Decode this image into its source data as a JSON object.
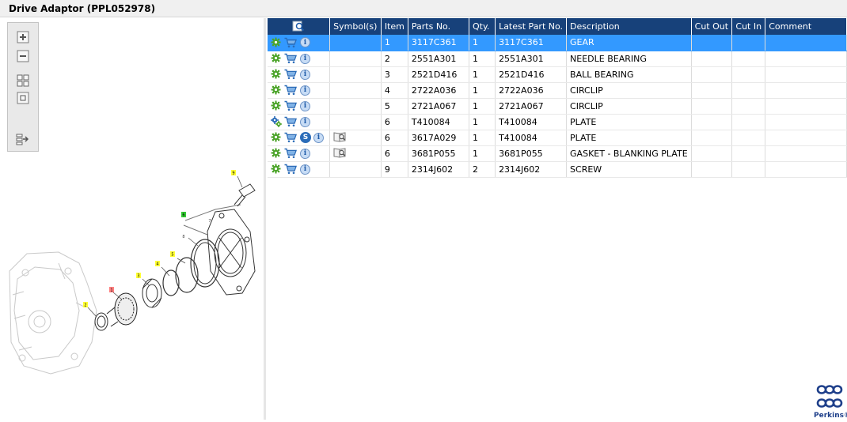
{
  "window": {
    "title": "Drive Adaptor (PPL052978)"
  },
  "colors": {
    "header_bg": "#17417a",
    "selected_row": "#3399ff",
    "brand": "#1e3f8a"
  },
  "toolbar": {
    "buttons": [
      {
        "name": "zoom-in-icon"
      },
      {
        "name": "zoom-out-icon"
      },
      {
        "name": "fit-all-icon"
      },
      {
        "name": "fit-window-icon"
      },
      {
        "name": "export-list-icon"
      }
    ]
  },
  "diagram": {
    "callouts": [
      "1",
      "2",
      "3",
      "4",
      "5",
      "6",
      "7",
      "8",
      "9"
    ]
  },
  "table": {
    "columns": [
      "",
      "Symbol(s)",
      "Item",
      "Parts No.",
      "Qty.",
      "Latest Part No.",
      "Description",
      "Cut Out",
      "Cut In",
      "Comment"
    ],
    "rows": [
      {
        "icons": [
          "gear",
          "cart",
          "info"
        ],
        "symbol": "",
        "item": "1",
        "part_no": "3117C361",
        "qty": "1",
        "latest": "3117C361",
        "desc": "GEAR",
        "cut_out": "",
        "cut_in": "",
        "comment": "",
        "selected": true
      },
      {
        "icons": [
          "gear",
          "cart",
          "info"
        ],
        "symbol": "",
        "item": "2",
        "part_no": "2551A301",
        "qty": "1",
        "latest": "2551A301",
        "desc": "NEEDLE BEARING",
        "cut_out": "",
        "cut_in": "",
        "comment": ""
      },
      {
        "icons": [
          "gear",
          "cart",
          "info"
        ],
        "symbol": "",
        "item": "3",
        "part_no": "2521D416",
        "qty": "1",
        "latest": "2521D416",
        "desc": "BALL BEARING",
        "cut_out": "",
        "cut_in": "",
        "comment": ""
      },
      {
        "icons": [
          "gear",
          "cart",
          "info"
        ],
        "symbol": "",
        "item": "4",
        "part_no": "2722A036",
        "qty": "1",
        "latest": "2722A036",
        "desc": "CIRCLIP",
        "cut_out": "",
        "cut_in": "",
        "comment": ""
      },
      {
        "icons": [
          "gear",
          "cart",
          "info"
        ],
        "symbol": "",
        "item": "5",
        "part_no": "2721A067",
        "qty": "1",
        "latest": "2721A067",
        "desc": "CIRCLIP",
        "cut_out": "",
        "cut_in": "",
        "comment": ""
      },
      {
        "icons": [
          "gears",
          "cart",
          "info"
        ],
        "symbol": "",
        "item": "6",
        "part_no": "T410084",
        "qty": "1",
        "latest": "T410084",
        "desc": "PLATE",
        "cut_out": "",
        "cut_in": "",
        "comment": ""
      },
      {
        "icons": [
          "gear",
          "cart",
          "s",
          "info"
        ],
        "symbol": "book",
        "item": "6",
        "part_no": "3617A029",
        "qty": "1",
        "latest": "T410084",
        "desc": "PLATE",
        "cut_out": "",
        "cut_in": "",
        "comment": ""
      },
      {
        "icons": [
          "gear",
          "cart",
          "info"
        ],
        "symbol": "book",
        "item": "6",
        "part_no": "3681P055",
        "qty": "1",
        "latest": "3681P055",
        "desc": "GASKET - BLANKING PLATE",
        "cut_out": "",
        "cut_in": "",
        "comment": ""
      },
      {
        "icons": [
          "gear",
          "cart",
          "info"
        ],
        "symbol": "",
        "item": "9",
        "part_no": "2314J602",
        "qty": "2",
        "latest": "2314J602",
        "desc": "SCREW",
        "cut_out": "",
        "cut_in": "",
        "comment": ""
      }
    ]
  },
  "brand": {
    "name": "Perkins",
    "trademark": "®"
  }
}
